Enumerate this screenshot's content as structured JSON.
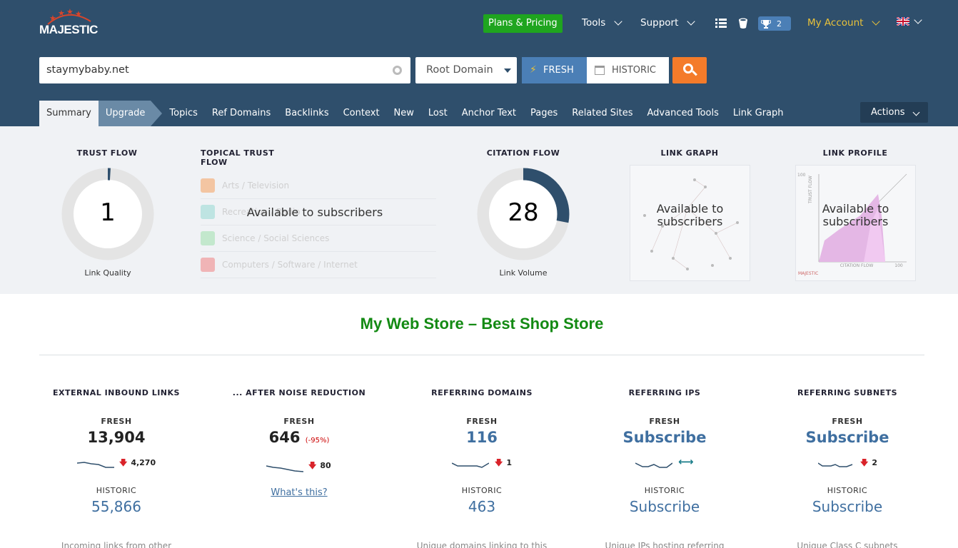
{
  "header": {
    "logo_text": "MAJESTIC",
    "plans_label": "Plans & Pricing",
    "nav": {
      "tools": "Tools",
      "support": "Support",
      "my_account": "My Account"
    },
    "trophy_count": "2"
  },
  "search": {
    "value": "staymybaby.net",
    "scope": "Root Domain",
    "fresh_label": "FRESH",
    "historic_label": "HISTORIC"
  },
  "tabs": [
    "Summary",
    "Upgrade",
    "Topics",
    "Ref Domains",
    "Backlinks",
    "Context",
    "New",
    "Lost",
    "Anchor Text",
    "Pages",
    "Related Sites",
    "Advanced Tools",
    "Link Graph"
  ],
  "actions_label": "Actions",
  "metrics": {
    "trust_flow": {
      "title": "TRUST FLOW",
      "value": "1",
      "fraction": 0.01,
      "sub": "Link Quality"
    },
    "topical": {
      "title": "TOPICAL TRUST FLOW",
      "overlay": "Available to subscribers",
      "items": [
        {
          "label": "Arts / Television",
          "color": "#f4c19a"
        },
        {
          "label": "Recreation / Radio",
          "color": "#b9e3e0"
        },
        {
          "label": "Science / Social Sciences",
          "color": "#bfe8c9"
        },
        {
          "label": "Computers / Software / Internet",
          "color": "#f1aeb0"
        }
      ]
    },
    "citation_flow": {
      "title": "CITATION FLOW",
      "value": "28",
      "fraction": 0.28,
      "sub": "Link Volume"
    },
    "link_graph": {
      "title": "LINK GRAPH",
      "overlay": "Available to subscribers"
    },
    "link_profile": {
      "title": "LINK PROFILE",
      "overlay": "Available to subscribers",
      "y_axis": "TRUST FLOW",
      "x_axis": "CITATION FLOW",
      "max": "100",
      "brand": "MAJESTIC"
    }
  },
  "site_title": "My Web Store – Best Shop Store",
  "stats": [
    {
      "title": "EXTERNAL INBOUND LINKS",
      "fresh_label": "FRESH",
      "fresh_value": "13,904",
      "delta": "4,270",
      "historic_label": "HISTORIC",
      "historic_value": "55,866",
      "desc": "Incoming links from other"
    },
    {
      "title": "... AFTER NOISE REDUCTION",
      "fresh_label": "FRESH",
      "fresh_value": "646",
      "pct": "(-95%)",
      "delta": "80",
      "link": "What's this?"
    },
    {
      "title": "REFERRING DOMAINS",
      "fresh_label": "FRESH",
      "fresh_value": "116",
      "delta": "1",
      "historic_label": "HISTORIC",
      "historic_value": "463",
      "desc": "Unique domains linking to this"
    },
    {
      "title": "REFERRING IPS",
      "fresh_label": "FRESH",
      "fresh_value": "Subscribe",
      "historic_label": "HISTORIC",
      "historic_value": "Subscribe",
      "desc": "Unique IPs hosting referring"
    },
    {
      "title": "REFERRING SUBNETS",
      "fresh_label": "FRESH",
      "fresh_value": "Subscribe",
      "delta": "2",
      "historic_label": "HISTORIC",
      "historic_value": "Subscribe",
      "desc": "Unique Class C subnets"
    }
  ]
}
